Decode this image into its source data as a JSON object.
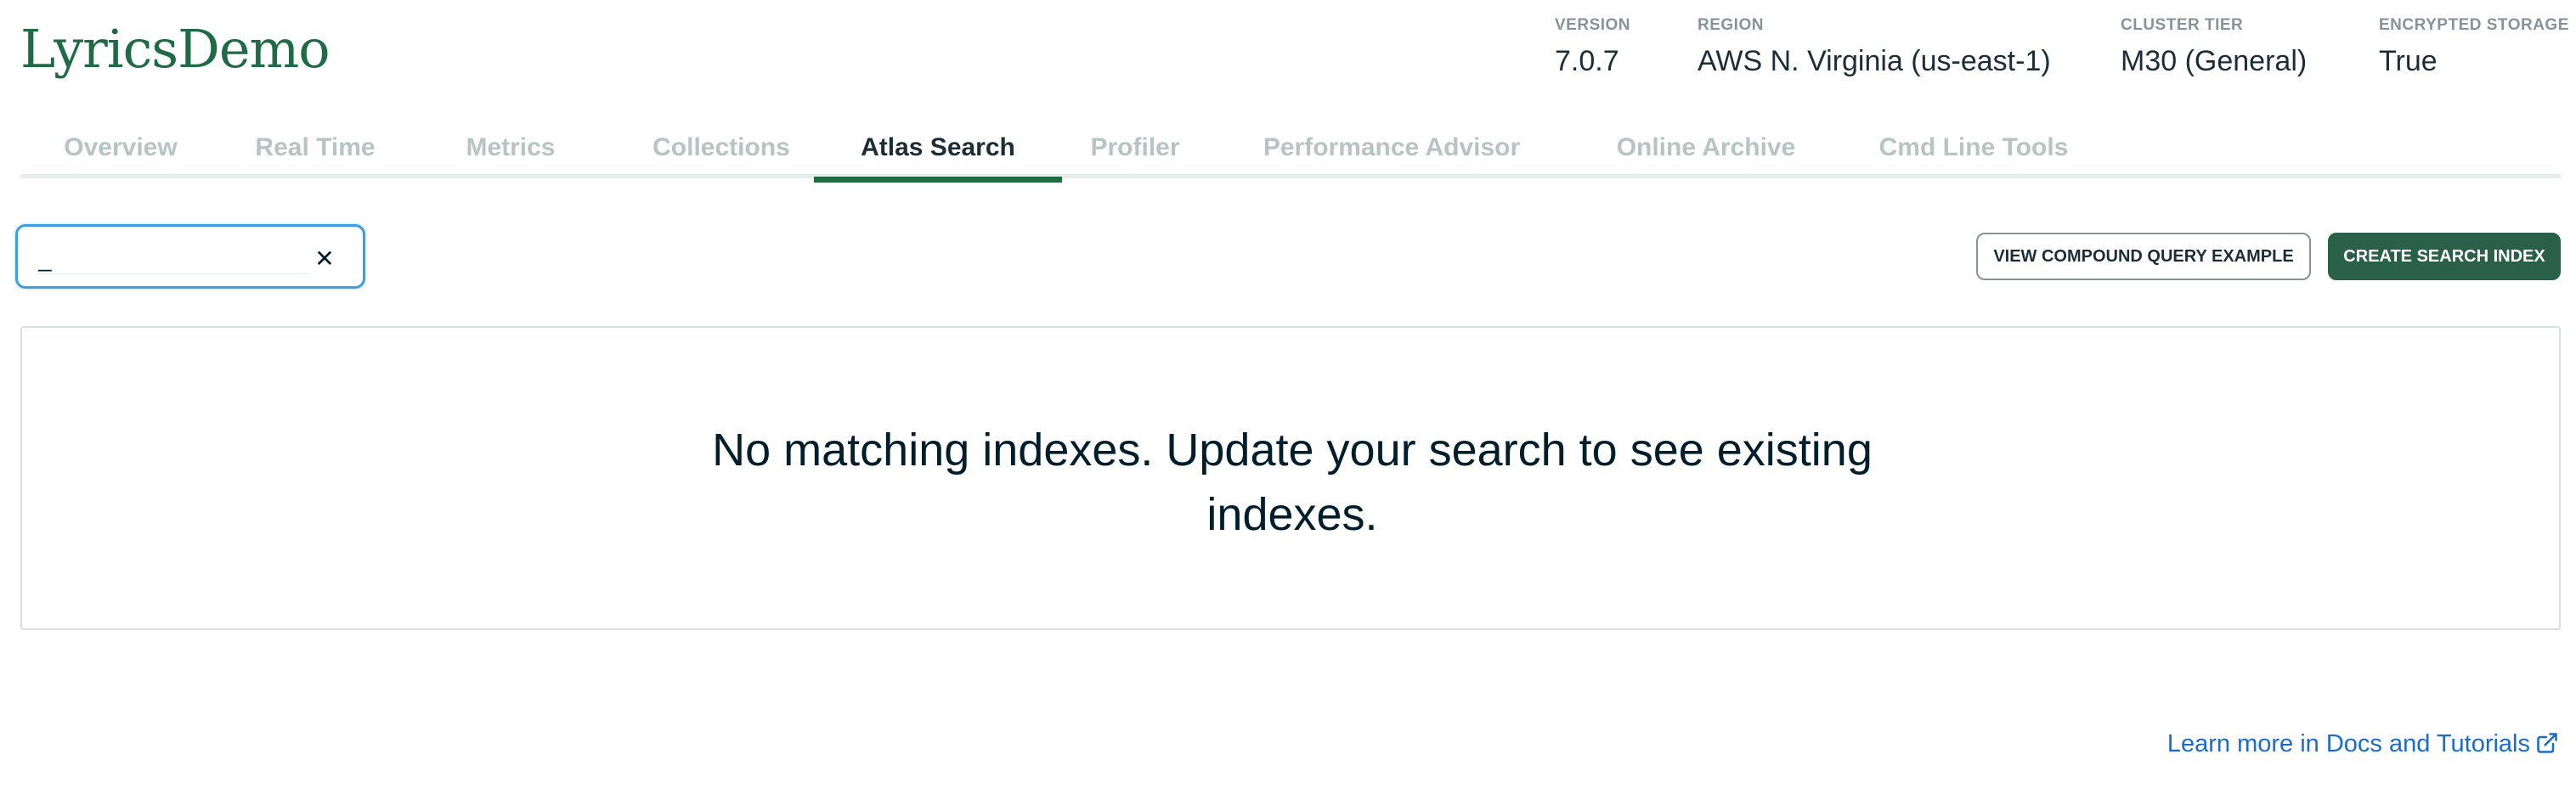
{
  "cluster": {
    "name": "LyricsDemo"
  },
  "meta": {
    "version": {
      "label": "VERSION",
      "value": "7.0.7"
    },
    "region": {
      "label": "REGION",
      "value": "AWS N. Virginia (us-east-1)"
    },
    "tier": {
      "label": "CLUSTER TIER",
      "value": "M30 (General)"
    },
    "storage": {
      "label": "ENCRYPTED STORAGE",
      "value": "True"
    }
  },
  "tabs": [
    {
      "label": "Overview",
      "active": false
    },
    {
      "label": "Real Time",
      "active": false
    },
    {
      "label": "Metrics",
      "active": false
    },
    {
      "label": "Collections",
      "active": false
    },
    {
      "label": "Atlas Search",
      "active": true
    },
    {
      "label": "Profiler",
      "active": false
    },
    {
      "label": "Performance Advisor",
      "active": false
    },
    {
      "label": "Online Archive",
      "active": false
    },
    {
      "label": "Cmd Line Tools",
      "active": false
    }
  ],
  "search": {
    "value": "_",
    "clear_icon": "close-icon"
  },
  "actions": {
    "compound_query_label": "VIEW COMPOUND QUERY EXAMPLE",
    "create_index_label": "CREATE SEARCH INDEX"
  },
  "empty_state": {
    "message": "No matching indexes. Update your search to see existing indexes."
  },
  "footer": {
    "docs_link": "Learn more in Docs and Tutorials",
    "docs_icon": "external-link-icon"
  },
  "colors": {
    "brand_green": "#1f6b45",
    "primary_button": "#2a6048",
    "link_blue": "#1a6ccc",
    "focus_blue": "#3aa0e0"
  }
}
